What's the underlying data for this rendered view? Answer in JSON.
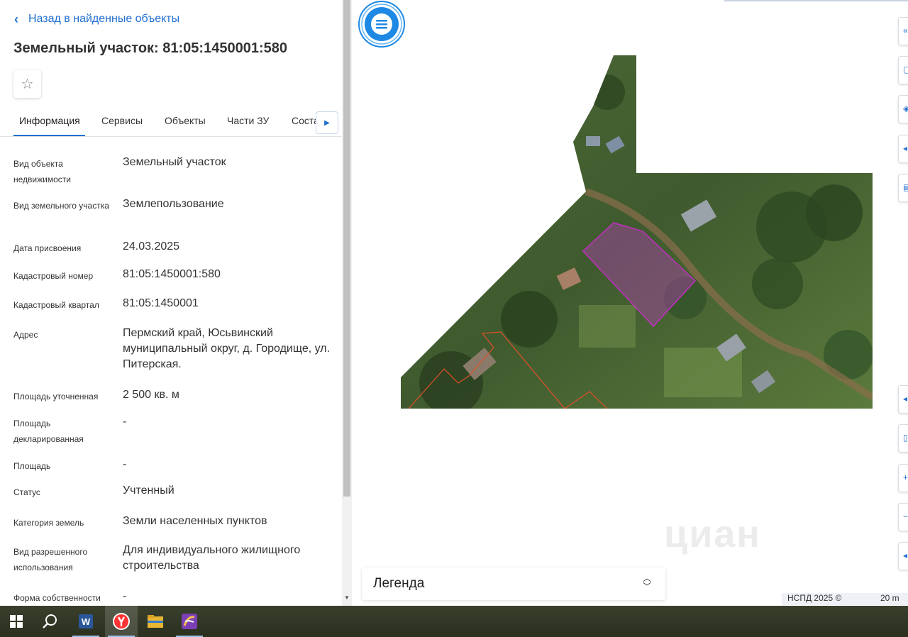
{
  "panel": {
    "back_label": "Назад в найденные объекты",
    "title": "Земельный участок: 81:05:1450001:580",
    "tabs": [
      "Информация",
      "Сервисы",
      "Объекты",
      "Части ЗУ",
      "Составы"
    ],
    "active_tab": "Информация",
    "fields": [
      {
        "label": "Вид объекта недвижимости",
        "value": "Земельный участок"
      },
      {
        "label": "Вид земельного участка",
        "value": "Землепользование"
      },
      {
        "label": "Дата присвоения",
        "value": "24.03.2025"
      },
      {
        "label": "Кадастровый номер",
        "value": "81:05:1450001:580"
      },
      {
        "label": "Кадастровый квартал",
        "value": "81:05:1450001"
      },
      {
        "label": "Адрес",
        "value": "Пермский край, Юсьвинский муниципальный округ, д. Городище, ул. Питерская."
      },
      {
        "label": "Площадь уточненная",
        "value": "2 500 кв. м"
      },
      {
        "label": "Площадь декларированная",
        "value": "-"
      },
      {
        "label": "Площадь",
        "value": "-"
      },
      {
        "label": "Статус",
        "value": "Учтенный"
      },
      {
        "label": "Категория земель",
        "value": "Земли населенных пунктов"
      },
      {
        "label": "Вид разрешенного использования",
        "value": "Для индивидуального жилищного строительства"
      },
      {
        "label": "Форма собственности",
        "value": "-"
      }
    ]
  },
  "map": {
    "legend_label": "Легенда",
    "attribution": "НСПД 2025 ©",
    "scale_label": "20 m",
    "watermark": "циан",
    "parcel_color": "#c02fc0",
    "neighbor_color": "#e0502a"
  },
  "taskbar": {
    "items": [
      "start-icon",
      "search-icon",
      "word-icon",
      "yandex-browser-icon",
      "file-explorer-icon",
      "app-icon"
    ]
  },
  "colors": {
    "accent": "#1f6fd1"
  }
}
